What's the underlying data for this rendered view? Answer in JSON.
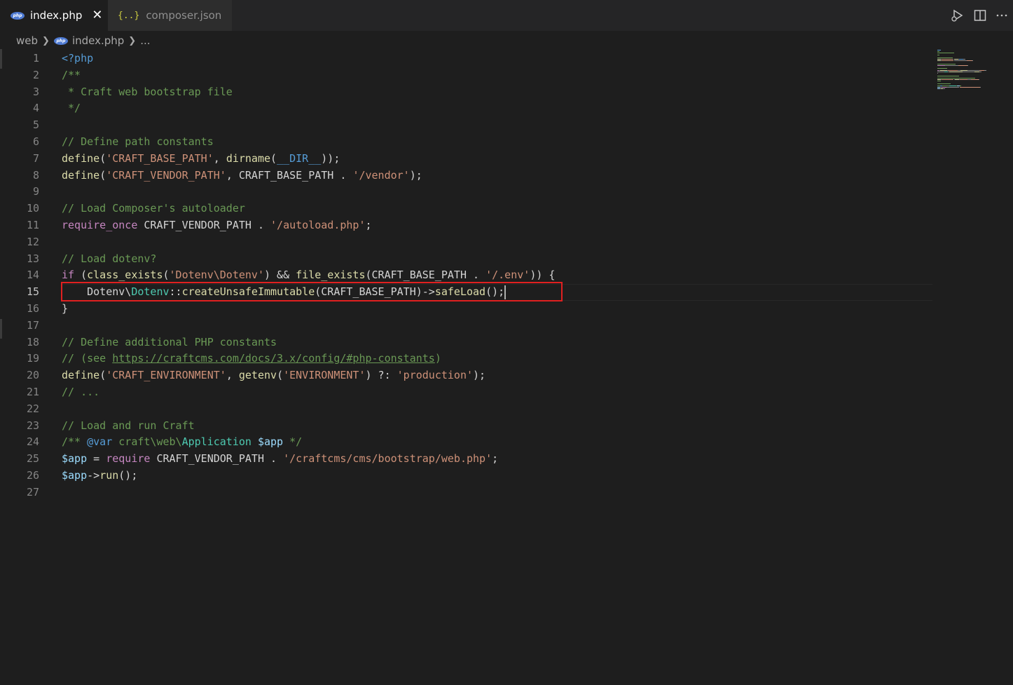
{
  "tabs": [
    {
      "label": "index.php",
      "icon": "php-icon",
      "active": true
    },
    {
      "label": "composer.json",
      "icon": "json-icon",
      "active": false
    }
  ],
  "tab_icons": {
    "php": "php",
    "json": "{..}"
  },
  "close_glyph": "✕",
  "top_actions": [
    "run-debug-icon",
    "split-editor-icon",
    "more-actions-icon"
  ],
  "breadcrumbs": {
    "folder": "web",
    "file": "index.php",
    "more": "..."
  },
  "editor": {
    "current_line": 15,
    "line_numbers": [
      "1",
      "2",
      "3",
      "4",
      "5",
      "6",
      "7",
      "8",
      "9",
      "10",
      "11",
      "12",
      "13",
      "14",
      "15",
      "16",
      "17",
      "18",
      "19",
      "20",
      "21",
      "22",
      "23",
      "24",
      "25",
      "26",
      "27"
    ],
    "lines": [
      [
        [
          "kw",
          "<?php"
        ]
      ],
      [
        [
          "cm",
          "/**"
        ]
      ],
      [
        [
          "cm",
          " * Craft web bootstrap file"
        ]
      ],
      [
        [
          "cm",
          " */"
        ]
      ],
      [],
      [
        [
          "cm",
          "// Define path constants"
        ]
      ],
      [
        [
          "fn",
          "define"
        ],
        [
          "const",
          "("
        ],
        [
          "str",
          "'CRAFT_BASE_PATH'"
        ],
        [
          "const",
          ", "
        ],
        [
          "fn",
          "dirname"
        ],
        [
          "const",
          "("
        ],
        [
          "kw",
          "__DIR__"
        ],
        [
          "const",
          "));"
        ]
      ],
      [
        [
          "fn",
          "define"
        ],
        [
          "const",
          "("
        ],
        [
          "str",
          "'CRAFT_VENDOR_PATH'"
        ],
        [
          "const",
          ", CRAFT_BASE_PATH . "
        ],
        [
          "str",
          "'/vendor'"
        ],
        [
          "const",
          ");"
        ]
      ],
      [],
      [
        [
          "cm",
          "// Load Composer's autoloader"
        ]
      ],
      [
        [
          "ctrl",
          "require_once"
        ],
        [
          "const",
          " CRAFT_VENDOR_PATH . "
        ],
        [
          "str",
          "'/autoload.php'"
        ],
        [
          "const",
          ";"
        ]
      ],
      [],
      [
        [
          "cm",
          "// Load dotenv?"
        ]
      ],
      [
        [
          "ctrl",
          "if"
        ],
        [
          "const",
          " ("
        ],
        [
          "fn",
          "class_exists"
        ],
        [
          "const",
          "("
        ],
        [
          "str",
          "'Dotenv\\Dotenv'"
        ],
        [
          "const",
          ") && "
        ],
        [
          "fn",
          "file_exists"
        ],
        [
          "const",
          "(CRAFT_BASE_PATH . "
        ],
        [
          "str",
          "'/.env'"
        ],
        [
          "const",
          ")) {"
        ]
      ],
      [
        [
          "const",
          "    Dotenv\\"
        ],
        [
          "cls",
          "Dotenv"
        ],
        [
          "const",
          "::"
        ],
        [
          "fn",
          "createUnsafeImmutable"
        ],
        [
          "const",
          "(CRAFT_BASE_PATH)->"
        ],
        [
          "fn",
          "safeLoad"
        ],
        [
          "const",
          "();"
        ]
      ],
      [
        [
          "const",
          "}"
        ]
      ],
      [],
      [
        [
          "cm",
          "// Define additional PHP constants"
        ]
      ],
      [
        [
          "cm",
          "// (see "
        ],
        [
          "cmlink",
          "https://craftcms.com/docs/3.x/config/#php-constants"
        ],
        [
          "cm",
          ")"
        ]
      ],
      [
        [
          "fn",
          "define"
        ],
        [
          "const",
          "("
        ],
        [
          "str",
          "'CRAFT_ENVIRONMENT'"
        ],
        [
          "const",
          ", "
        ],
        [
          "fn",
          "getenv"
        ],
        [
          "const",
          "("
        ],
        [
          "str",
          "'ENVIRONMENT'"
        ],
        [
          "const",
          ") ?: "
        ],
        [
          "str",
          "'production'"
        ],
        [
          "const",
          ");"
        ]
      ],
      [
        [
          "cm",
          "// ..."
        ]
      ],
      [],
      [
        [
          "cm",
          "// Load and run Craft"
        ]
      ],
      [
        [
          "cm",
          "/** "
        ],
        [
          "kw",
          "@var"
        ],
        [
          "cm",
          " craft\\web\\"
        ],
        [
          "cls",
          "Application"
        ],
        [
          "cm",
          " "
        ],
        [
          "var",
          "$app"
        ],
        [
          "cm",
          " */"
        ]
      ],
      [
        [
          "var",
          "$app"
        ],
        [
          "const",
          " = "
        ],
        [
          "ctrl",
          "require"
        ],
        [
          "const",
          " CRAFT_VENDOR_PATH . "
        ],
        [
          "str",
          "'/craftcms/cms/bootstrap/web.php'"
        ],
        [
          "const",
          ";"
        ]
      ],
      [
        [
          "var",
          "$app"
        ],
        [
          "const",
          "->"
        ],
        [
          "fn",
          "run"
        ],
        [
          "const",
          "();"
        ]
      ],
      []
    ]
  },
  "colors": {
    "background": "#1e1e1e",
    "highlight_box": "#e02020",
    "keyword": "#569cd6",
    "string": "#ce9178",
    "comment": "#6a9955",
    "function": "#dcdcaa",
    "class": "#4ec9b0"
  }
}
